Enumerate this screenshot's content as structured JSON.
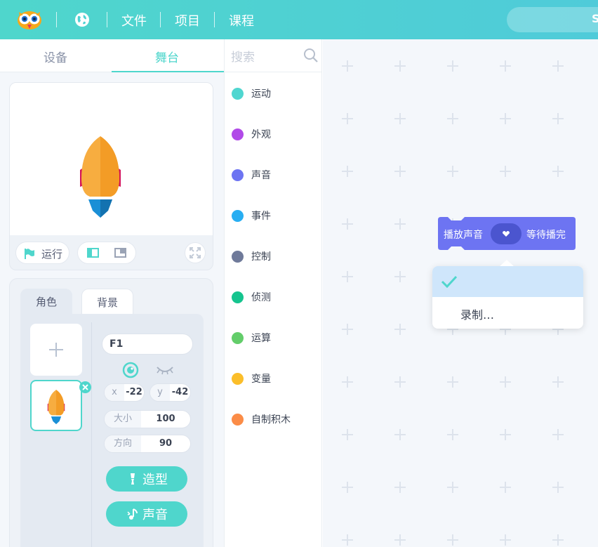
{
  "topbar": {
    "menu": [
      "文件",
      "项目",
      "课程"
    ],
    "search_placeholder": "S"
  },
  "left_tabs": {
    "devices": "设备",
    "stage": "舞台"
  },
  "stage": {
    "run_label": "运行"
  },
  "sprite_panel": {
    "tab_role": "角色",
    "tab_background": "背景",
    "name_value": "F1",
    "x_label": "x",
    "x_value": "-22",
    "y_label": "y",
    "y_value": "-42",
    "size_label": "大小",
    "size_value": "100",
    "direction_label": "方向",
    "direction_value": "90",
    "costume_button": "造型",
    "sound_button": "声音"
  },
  "categories": {
    "search_placeholder": "搜索",
    "items": [
      {
        "label": "运动",
        "color": "#4fd6d0"
      },
      {
        "label": "外观",
        "color": "#b14ae8"
      },
      {
        "label": "声音",
        "color": "#6d74f2"
      },
      {
        "label": "事件",
        "color": "#28aef2"
      },
      {
        "label": "控制",
        "color": "#6f7a9a"
      },
      {
        "label": "侦测",
        "color": "#15c48e"
      },
      {
        "label": "运算",
        "color": "#63cd6a"
      },
      {
        "label": "变量",
        "color": "#fbbe2a"
      },
      {
        "label": "自制积木",
        "color": "#fb8c47"
      }
    ]
  },
  "workspace": {
    "block": {
      "prefix": "播放声音",
      "suffix": "等待播完",
      "color": "#6d74f2"
    },
    "dropdown": {
      "items": [
        "",
        "录制…"
      ],
      "selected_index": 0
    }
  },
  "colors": {
    "accent": "#4fd6cc"
  }
}
